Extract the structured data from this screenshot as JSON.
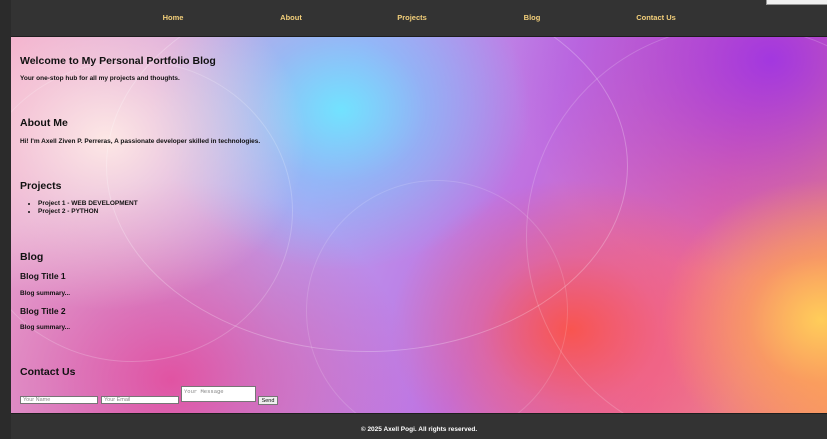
{
  "nav": {
    "items": [
      {
        "label": "Home"
      },
      {
        "label": "About"
      },
      {
        "label": "Projects"
      },
      {
        "label": "Blog"
      },
      {
        "label": "Contact Us"
      }
    ],
    "link_color": "#f3cf7a",
    "background": "#333333"
  },
  "hero": {
    "title": "Welcome to My Personal Portfolio Blog",
    "subtitle": "Your one-stop hub for all my projects and thoughts."
  },
  "about": {
    "heading": "About Me",
    "text": "Hi! I'm Axell Ziven P. Perreras, A passionate developer skilled in technologies."
  },
  "projects": {
    "heading": "Projects",
    "items": [
      "Project 1 - WEB DEVELOPMENT",
      "Project 2 - PYTHON"
    ]
  },
  "blog": {
    "heading": "Blog",
    "posts": [
      {
        "title": "Blog Title 1",
        "summary": "Blog summary..."
      },
      {
        "title": "Blog Title 2",
        "summary": "Blog summary..."
      }
    ]
  },
  "contact": {
    "heading": "Contact Us",
    "name_placeholder": "Your Name",
    "email_placeholder": "Your Email",
    "message_placeholder": "Your Message",
    "send_label": "Send"
  },
  "footer": {
    "text": "© 2025 Axell Pogi. All rights reserved."
  }
}
